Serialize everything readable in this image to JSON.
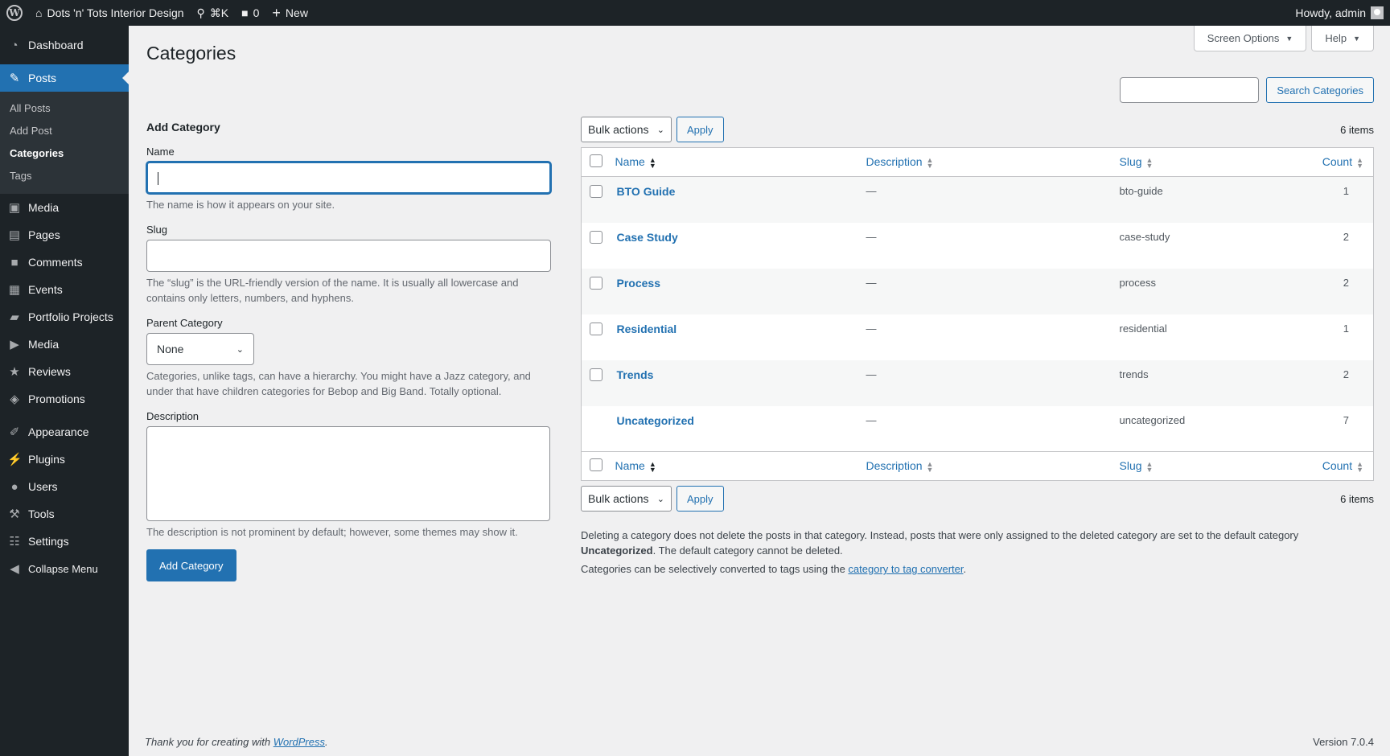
{
  "adminbar": {
    "site_name": "Dots 'n' Tots Interior Design",
    "search_shortcut": "⌘K",
    "comments_count": "0",
    "new_label": "New",
    "howdy": "Howdy, admin"
  },
  "sidebar": {
    "items": [
      {
        "label": "Dashboard",
        "icon": "dashboard-icon"
      },
      {
        "label": "Posts",
        "icon": "pin-icon"
      },
      {
        "label": "Media",
        "icon": "media-icon"
      },
      {
        "label": "Pages",
        "icon": "pages-icon"
      },
      {
        "label": "Comments",
        "icon": "comments-icon"
      },
      {
        "label": "Events",
        "icon": "calendar-icon"
      },
      {
        "label": "Portfolio Projects",
        "icon": "folder-icon"
      },
      {
        "label": "Media",
        "icon": "video-icon"
      },
      {
        "label": "Reviews",
        "icon": "star-icon"
      },
      {
        "label": "Promotions",
        "icon": "tag-icon"
      },
      {
        "label": "Appearance",
        "icon": "brush-icon"
      },
      {
        "label": "Plugins",
        "icon": "plugin-icon"
      },
      {
        "label": "Users",
        "icon": "users-icon"
      },
      {
        "label": "Tools",
        "icon": "wrench-icon"
      },
      {
        "label": "Settings",
        "icon": "settings-icon"
      },
      {
        "label": "Collapse Menu",
        "icon": "collapse-icon"
      }
    ],
    "posts_submenu": [
      "All Posts",
      "Add Post",
      "Categories",
      "Tags"
    ]
  },
  "header": {
    "title": "Categories",
    "screen_options": "Screen Options",
    "help": "Help",
    "search_button": "Search Categories"
  },
  "form": {
    "heading": "Add Category",
    "name_label": "Name",
    "name_value": "",
    "name_help": "The name is how it appears on your site.",
    "slug_label": "Slug",
    "slug_value": "",
    "slug_help": "The “slug” is the URL-friendly version of the name. It is usually all lowercase and contains only letters, numbers, and hyphens.",
    "parent_label": "Parent Category",
    "parent_value": "None",
    "parent_help": "Categories, unlike tags, can have a hierarchy. You might have a Jazz category, and under that have children categories for Bebop and Big Band. Totally optional.",
    "desc_label": "Description",
    "desc_help": "The description is not prominent by default; however, some themes may show it.",
    "submit": "Add Category"
  },
  "list": {
    "bulk_actions": "Bulk actions",
    "apply": "Apply",
    "items_count": "6 items",
    "columns": {
      "name": "Name",
      "description": "Description",
      "slug": "Slug",
      "count": "Count"
    },
    "rows": [
      {
        "name": "BTO Guide",
        "description": "—",
        "slug": "bto-guide",
        "count": "1"
      },
      {
        "name": "Case Study",
        "description": "—",
        "slug": "case-study",
        "count": "2"
      },
      {
        "name": "Process",
        "description": "—",
        "slug": "process",
        "count": "2"
      },
      {
        "name": "Residential",
        "description": "—",
        "slug": "residential",
        "count": "1"
      },
      {
        "name": "Trends",
        "description": "—",
        "slug": "trends",
        "count": "2"
      },
      {
        "name": "Uncategorized",
        "description": "—",
        "slug": "uncategorized",
        "count": "7"
      }
    ],
    "note1_a": "Deleting a category does not delete the posts in that category. Instead, posts that were only assigned to the deleted category are set to the default category ",
    "note1_b": "Uncategorized",
    "note1_c": ". The default category cannot be deleted.",
    "note2_a": "Categories can be selectively converted to tags using the ",
    "note2_link": "category to tag converter",
    "note2_b": "."
  },
  "footer": {
    "thanks": "Thank you for creating with ",
    "wp_link": "WordPress",
    "period": ".",
    "version": "Version 7.0.4"
  }
}
